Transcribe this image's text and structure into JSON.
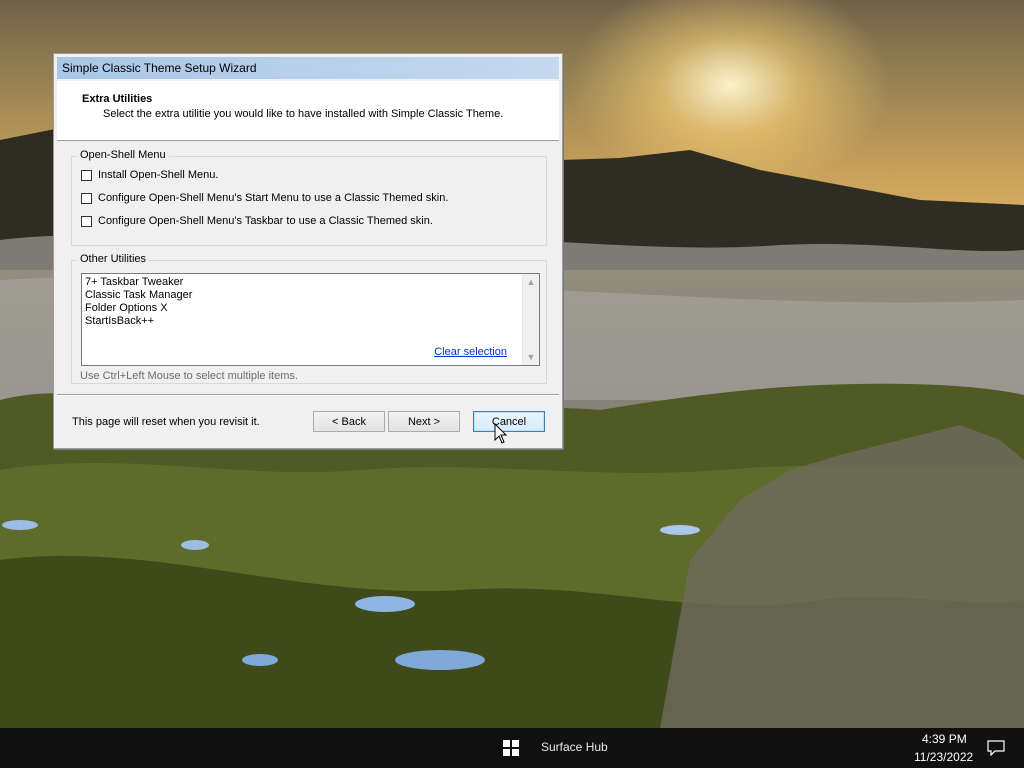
{
  "window": {
    "title": "Simple Classic Theme Setup Wizard"
  },
  "header": {
    "title": "Extra Utilities",
    "subtitle": "Select the extra utilitie you would like to have installed with Simple Classic Theme."
  },
  "open_shell_group": {
    "label": "Open-Shell Menu",
    "options": [
      {
        "label": "Install Open-Shell Menu.",
        "checked": false
      },
      {
        "label": "Configure Open-Shell Menu's Start Menu to use a Classic Themed skin.",
        "checked": false
      },
      {
        "label": "Configure Open-Shell Menu's Taskbar to use a Classic Themed skin.",
        "checked": false
      }
    ]
  },
  "other_group": {
    "label": "Other Utilities",
    "items": [
      "7+ Taskbar Tweaker",
      "Classic Task Manager",
      "Folder Options X",
      "StartIsBack++"
    ],
    "clear_link": "Clear selection",
    "hint": "Use Ctrl+Left Mouse to select multiple items."
  },
  "footer": {
    "note": "This page will reset when you revisit it.",
    "back_label": "< Back",
    "next_label": "Next >",
    "cancel_label": "Cancel"
  },
  "taskbar": {
    "app_label": "Surface Hub",
    "time": "4:39 PM",
    "date": "11/23/2022"
  },
  "icons": {
    "start": "windows-logo-icon",
    "notifications": "action-center-icon",
    "cursor": "mouse-pointer-icon"
  }
}
